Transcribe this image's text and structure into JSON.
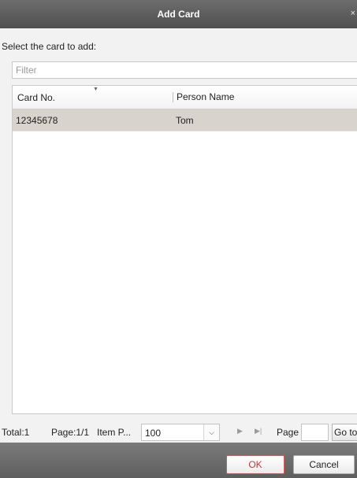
{
  "dialog": {
    "title": "Add Card",
    "close_glyph": "×"
  },
  "prompt": "Select the card to add:",
  "filter": {
    "value": "",
    "placeholder": "Filter"
  },
  "table": {
    "columns": [
      "Card No.",
      "Person Name"
    ],
    "sort_indicator": "▼",
    "rows": [
      {
        "card_no": "12345678",
        "person_name": "Tom",
        "selected": true
      }
    ]
  },
  "pager": {
    "total": "Total:1",
    "page": "Page:1/1",
    "item_label": "Item P...",
    "items_per_page": "100",
    "next_glyph": "▶",
    "last_glyph": "▶|",
    "page_label": "Page",
    "page_input": "",
    "go_label": "Go to"
  },
  "footer": {
    "ok_label": "OK",
    "cancel_label": "Cancel"
  },
  "colors": {
    "titlebar": "#5c5c5c",
    "selected_row": "#d8d3cc",
    "ok_border": "#d25a5a"
  }
}
